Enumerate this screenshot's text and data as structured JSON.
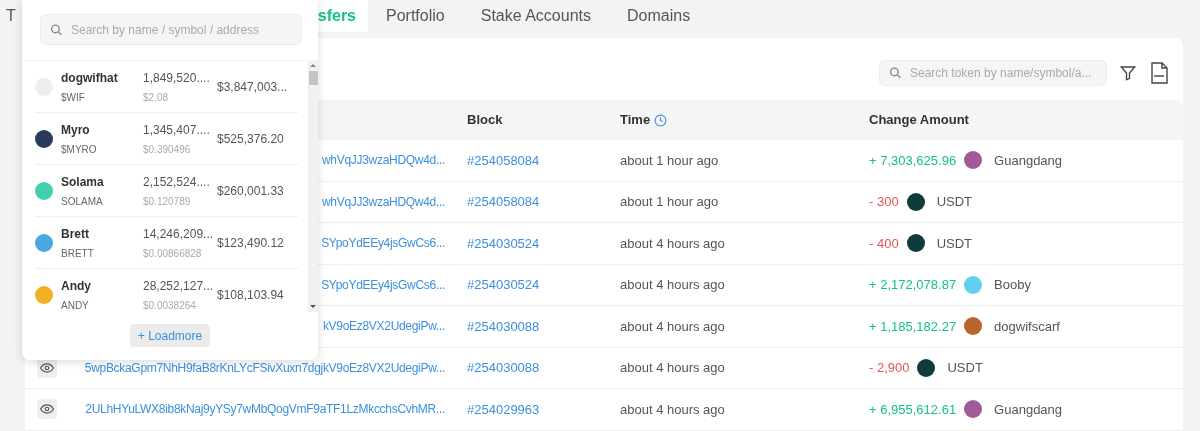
{
  "tabs": [
    {
      "label": "T",
      "selected": false
    },
    {
      "label": "sfers",
      "selected": true
    },
    {
      "label": "Portfolio",
      "selected": false
    },
    {
      "label": "Stake Accounts",
      "selected": false
    },
    {
      "label": "Domains",
      "selected": false
    }
  ],
  "token_search": {
    "placeholder": "Search token by name/symbol/a..."
  },
  "table": {
    "columns": [
      "Block",
      "Time",
      "Change Amount"
    ],
    "rows": [
      {
        "eye_button": false,
        "signature": "whVqJJ3wzaHDQw4d...",
        "block": "#254058084",
        "time": "about 1 hour ago",
        "change": "+ 7,303,625.96",
        "kind": "in",
        "token": "Guangdang",
        "color": "#a05a9a"
      },
      {
        "eye_button": false,
        "signature": "whVqJJ3wzaHDQw4d...",
        "block": "#254058084",
        "time": "about 1 hour ago",
        "change": "- 300",
        "kind": "out",
        "token": "USDT",
        "color": "#0f3b3b"
      },
      {
        "eye_button": false,
        "signature": "SYpoYdEEy4jsGwCs6...",
        "block": "#254030524",
        "time": "about 4 hours ago",
        "change": "- 400",
        "kind": "out",
        "token": "USDT",
        "color": "#0f3b3b"
      },
      {
        "eye_button": false,
        "signature": "SYpoYdEEy4jsGwCs6...",
        "block": "#254030524",
        "time": "about 4 hours ago",
        "change": "+ 2,172,078.87",
        "kind": "in",
        "token": "Booby",
        "color": "#5fd0f0"
      },
      {
        "eye_button": false,
        "signature": "kV9oEz8VX2UdegiPw...",
        "block": "#254030088",
        "time": "about 4 hours ago",
        "change": "+ 1,185,182.27",
        "kind": "in",
        "token": "dogwifscarf",
        "color": "#b8662a"
      },
      {
        "eye_button": true,
        "signature": "5wpBckaGpm7NhH9faB8rKnLYcFSivXuxn7dgjkV9oEz8VX2UdegiPw...",
        "block": "#254030088",
        "time": "about 4 hours ago",
        "change": "- 2,900",
        "kind": "out",
        "token": "USDT",
        "color": "#0f3b3b"
      },
      {
        "eye_button": true,
        "signature": "2ULhHYuLWX8ib8kNaj9yYSy7wMbQogVmF9aTF1LzMkcchsCvhMR...",
        "block": "#254029963",
        "time": "about 4 hours ago",
        "change": "+ 6,955,612.61",
        "kind": "in",
        "token": "Guangdang",
        "color": "#a05a9a"
      }
    ]
  },
  "dropdown": {
    "search": {
      "placeholder": "Search by name / symbol / address"
    },
    "items": [
      {
        "name": "dogwifhat",
        "symbol": "$WIF",
        "amount": "1,849,520....",
        "price": "$2.08",
        "value": "$3,847,003...",
        "color": "#eeeeee"
      },
      {
        "name": "Myro",
        "symbol": "$MYRO",
        "amount": "1,345,407....",
        "price": "$0.390496",
        "value": "$525,376.20",
        "color": "#2a3a5a"
      },
      {
        "name": "Solama",
        "symbol": "SOLAMA",
        "amount": "2,152,524....",
        "price": "$0.120789",
        "value": "$260,001.33",
        "color": "#40d0b0"
      },
      {
        "name": "Brett",
        "symbol": "BRETT",
        "amount": "14,246,209...",
        "price": "$0.00866828",
        "value": "$123,490.12",
        "color": "#4aa8e0"
      },
      {
        "name": "Andy",
        "symbol": "ANDY",
        "amount": "28,252,127...",
        "price": "$0.0038264",
        "value": "$108,103.94",
        "color": "#f0b020"
      }
    ],
    "load_more": "+ Loadmore"
  }
}
